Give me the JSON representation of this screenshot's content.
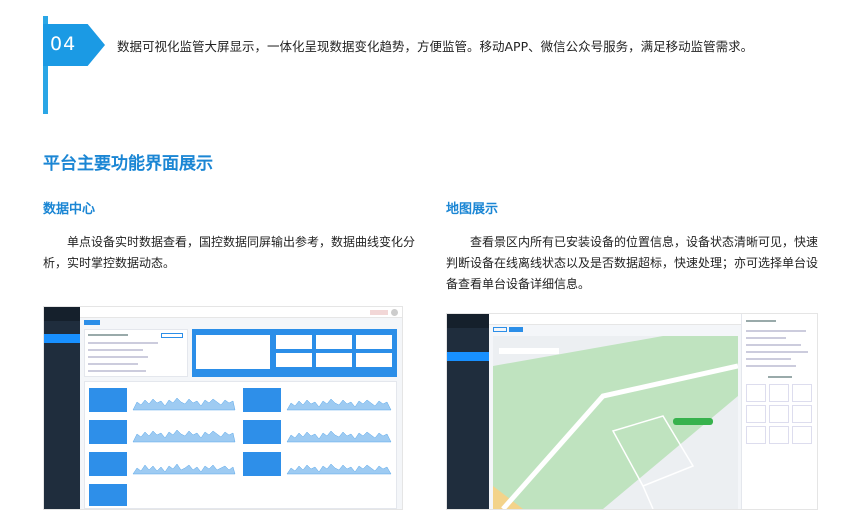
{
  "header": {
    "step_number": "04",
    "intro_text": "数据可视化监管大屏显示，一体化呈现数据变化趋势，方便监管。移动APP、微信公众号服务，满足移动监管需求。"
  },
  "section_title": "平台主要功能界面展示",
  "left": {
    "title": "数据中心",
    "paragraph": "单点设备实时数据查看，国控数据同屏输出参考，数据曲线变化分析，实时掌控数据动态。"
  },
  "right": {
    "title": "地图展示",
    "paragraph": "查看景区内所有已安装设备的位置信息，设备状态清晰可见，快速判断设备在线离线状态以及是否数据超标，快速处理；亦可选择单台设备查看单台设备详细信息。"
  },
  "colors": {
    "accent": "#1b86d4",
    "flag": "#1b9ae4",
    "sidebar": "#1f2d3d",
    "tile": "#2e8fe9"
  }
}
